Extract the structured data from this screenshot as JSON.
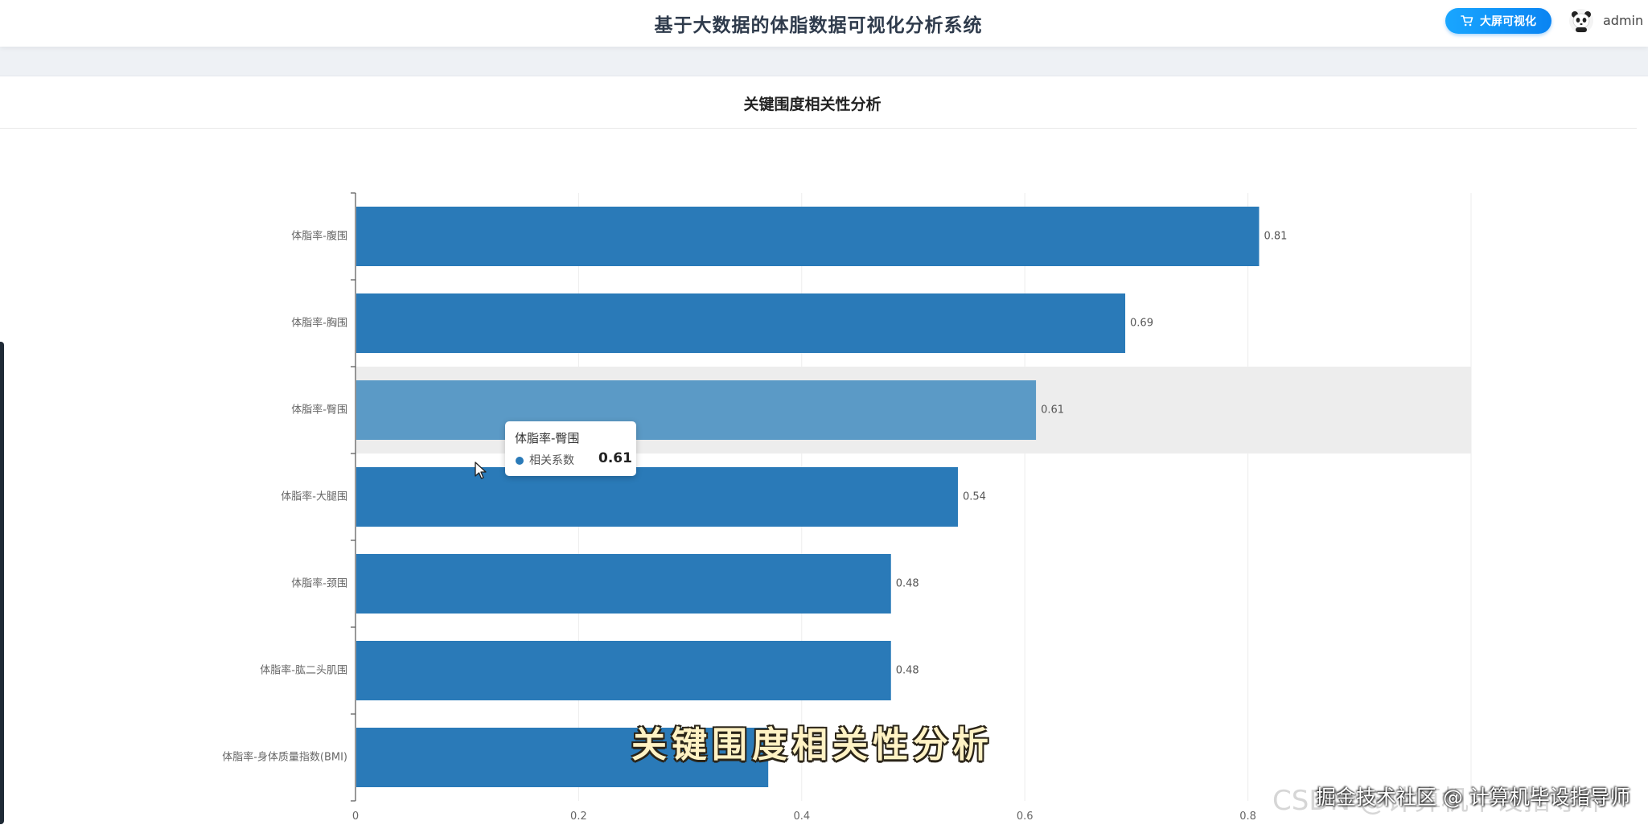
{
  "header": {
    "title": "基于大数据的体脂数据可视化分析系统",
    "bigscreen_label": "大屏可视化",
    "username": "admin"
  },
  "panel": {
    "title": "关键围度相关性分析"
  },
  "chart_data": {
    "type": "bar",
    "orientation": "horizontal",
    "categories": [
      "体脂率-腹围",
      "体脂率-胸围",
      "体脂率-臀围",
      "体脂率-大腿围",
      "体脂率-颈围",
      "体脂率-肱二头肌围",
      "体脂率-身体质量指数(BMI)"
    ],
    "series": [
      {
        "name": "相关系数",
        "values": [
          0.81,
          0.69,
          0.61,
          0.54,
          0.48,
          0.48,
          0.37
        ]
      }
    ],
    "data_labels": [
      "0.81",
      "0.69",
      "0.61",
      "0.54",
      "0.48",
      "0.48",
      ""
    ],
    "x_ticks": [
      "0",
      "0.2",
      "0.4",
      "0.6",
      "0.8"
    ],
    "xlim": [
      0,
      1
    ],
    "grid": true,
    "bar_color": "#2a7ab8",
    "highlight_color": "#5b9ac6",
    "highlighted_index": 2
  },
  "tooltip": {
    "title": "体脂率-臀围",
    "label": "相关系数",
    "value": "0.61"
  },
  "overlay": {
    "caption": "关键围度相关性分析",
    "watermark_back": "CSDN @计算机毕设指导师",
    "watermark_front": "掘金技术社区 @ 计算机毕设指导师"
  }
}
